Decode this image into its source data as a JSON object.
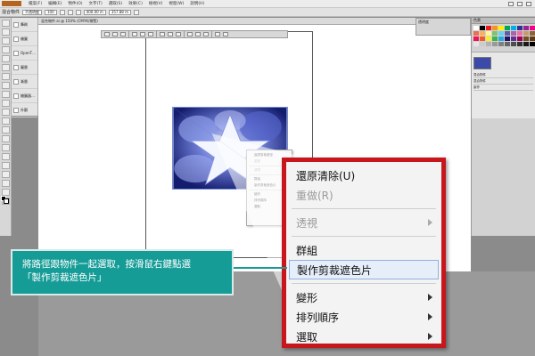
{
  "app": {
    "doc_tab": "混合物件.ai @ 150% (CMYK/預覽)",
    "menu": [
      "檔案(F)",
      "編輯(E)",
      "物件(O)",
      "文字(T)",
      "選取(S)",
      "效果(C)",
      "檢視(V)",
      "視窗(W)",
      "說明(H)"
    ],
    "control_bar": {
      "label_left": "混合物件",
      "stroke": "不透明度",
      "opacity": "100",
      "x": "400.00 m",
      "y": "357.88 m"
    }
  },
  "symbols_panel": [
    "筆刷",
    "繪圖",
    "OpenT…",
    "圖層",
    "漸層",
    "繪圖器…",
    "外觀"
  ],
  "small_context_menu": [
    "還原剪裁路徑",
    "重做",
    "透視",
    "群組",
    "製作剪裁遮色片",
    "變形",
    "排列順序",
    "選取"
  ],
  "context_menu": {
    "items": [
      {
        "label": "還原清除(U)",
        "enabled": true,
        "submenu": false
      },
      {
        "label": "重做(R)",
        "enabled": false,
        "submenu": false
      },
      {
        "label": "透視",
        "enabled": false,
        "submenu": true
      },
      {
        "label": "群組",
        "enabled": true,
        "submenu": false
      },
      {
        "label": "製作剪裁遮色片",
        "enabled": true,
        "submenu": false,
        "highlighted": true
      },
      {
        "label": "變形",
        "enabled": true,
        "submenu": true
      },
      {
        "label": "排列順序",
        "enabled": true,
        "submenu": true
      },
      {
        "label": "選取",
        "enabled": true,
        "submenu": true
      }
    ]
  },
  "callout": {
    "line1": "將路徑跟物件一起選取，按滑鼠右鍵點選",
    "line2": "「製作剪裁遮色片」"
  },
  "layers_panel": {
    "header": "透明度",
    "rows": [
      "混合物件",
      "混合物件",
      "製作"
    ]
  },
  "colors": {
    "callout_bg": "#169c97",
    "menu_border": "#c8161d",
    "highlight_bg": "#e6eef9"
  }
}
